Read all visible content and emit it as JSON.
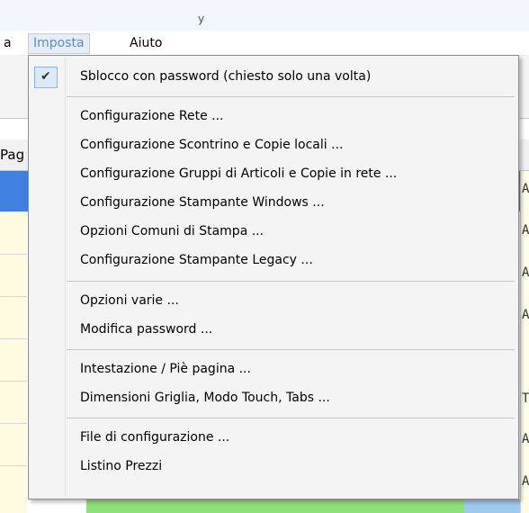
{
  "titlebar": {
    "glyph": "y"
  },
  "menubar": {
    "partial_item": "a",
    "items": [
      {
        "label": "Imposta",
        "active": true
      },
      {
        "label": "Aiuto",
        "active": false
      }
    ]
  },
  "background": {
    "column_header": "Pag",
    "right_letters": [
      "A",
      "A",
      "A",
      "A",
      "T",
      "A",
      "A"
    ]
  },
  "dropdown": {
    "checked_item": {
      "label": "Sblocco con password (chiesto solo una volta)",
      "icon": "check-icon",
      "checked": true
    },
    "group_config": [
      "Configurazione Rete ...",
      "Configurazione Scontrino e Copie locali ...",
      "Configurazione Gruppi di Articoli e Copie in rete ...",
      "Configurazione Stampante Windows ...",
      "Opzioni Comuni di Stampa ...",
      "Configurazione Stampante Legacy ..."
    ],
    "group_misc": [
      "Opzioni varie ...",
      "Modifica password ..."
    ],
    "group_layout": [
      "Intestazione / Piè pagina ...",
      "Dimensioni Griglia, Modo Touch, Tabs ..."
    ],
    "group_files": [
      "File di configurazione ...",
      "Listino Prezzi"
    ]
  },
  "colors": {
    "menu_active_text": "#5b8cc0",
    "check_highlight": "#dceaf8",
    "selected_row": "#3f80e0",
    "row_background": "#fffbe0"
  }
}
